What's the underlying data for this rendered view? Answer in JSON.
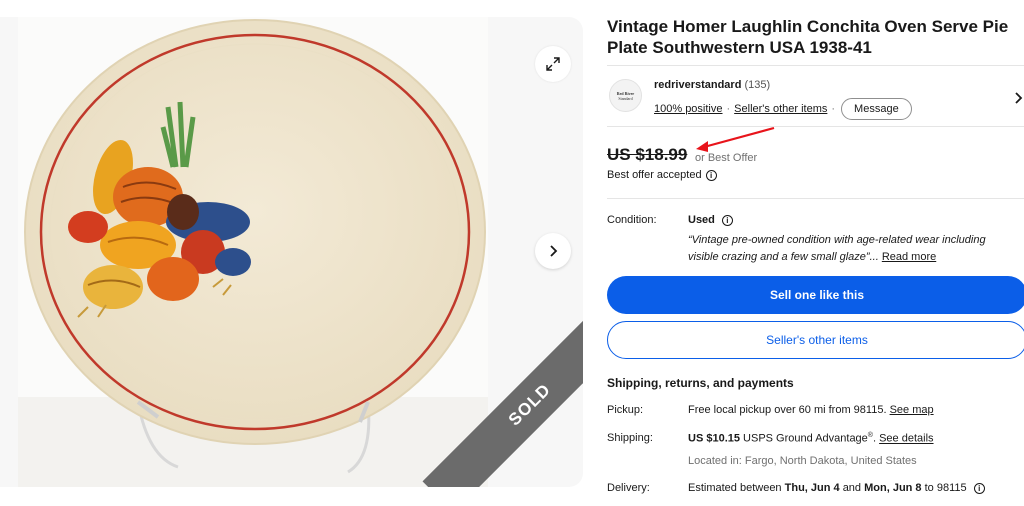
{
  "gallery": {
    "sold_label": "SOLD",
    "expand_icon": "expand-icon",
    "next_icon": "chevron-right-icon"
  },
  "listing": {
    "title": "Vintage Homer Laughlin Conchita Oven Serve Pie Plate Southwestern USA 1938-41"
  },
  "seller": {
    "logo_line1": "Red River",
    "logo_line2": "Standard",
    "name": "redriverstandard",
    "feedback_count": "(135)",
    "positive": "100% positive",
    "separator": "·",
    "other_items": "Seller's other items",
    "message_label": "Message"
  },
  "price": {
    "amount": "US $18.99",
    "or_best_offer": "or Best Offer",
    "offer_status": "Best offer accepted"
  },
  "condition": {
    "label": "Condition:",
    "value": "Used",
    "quote": "“Vintage pre-owned condition with age-related wear including visible crazing and a few small glaze”...",
    "read_more": "Read more"
  },
  "actions": {
    "sell_one": "Sell one like this",
    "other_items": "Seller's other items"
  },
  "shipping": {
    "heading": "Shipping, returns, and payments",
    "pickup_label": "Pickup:",
    "pickup_value": "Free local pickup over 60 mi from 98115.",
    "see_map": "See map",
    "shipping_label": "Shipping:",
    "shipping_price": "US $10.15",
    "shipping_service": "USPS Ground Advantage",
    "registered": "®",
    "see_details": "See details",
    "located": "Located in: Fargo, North Dakota, United States",
    "delivery_label": "Delivery:",
    "delivery_prefix": "Estimated between",
    "delivery_start": "Thu, Jun 4",
    "delivery_and": "and",
    "delivery_end": "Mon, Jun 8",
    "delivery_to": "to 98115"
  },
  "colors": {
    "primary": "#0b5ee8",
    "annotation_arrow": "#e8141b",
    "plate_rim": "#c0392b"
  }
}
